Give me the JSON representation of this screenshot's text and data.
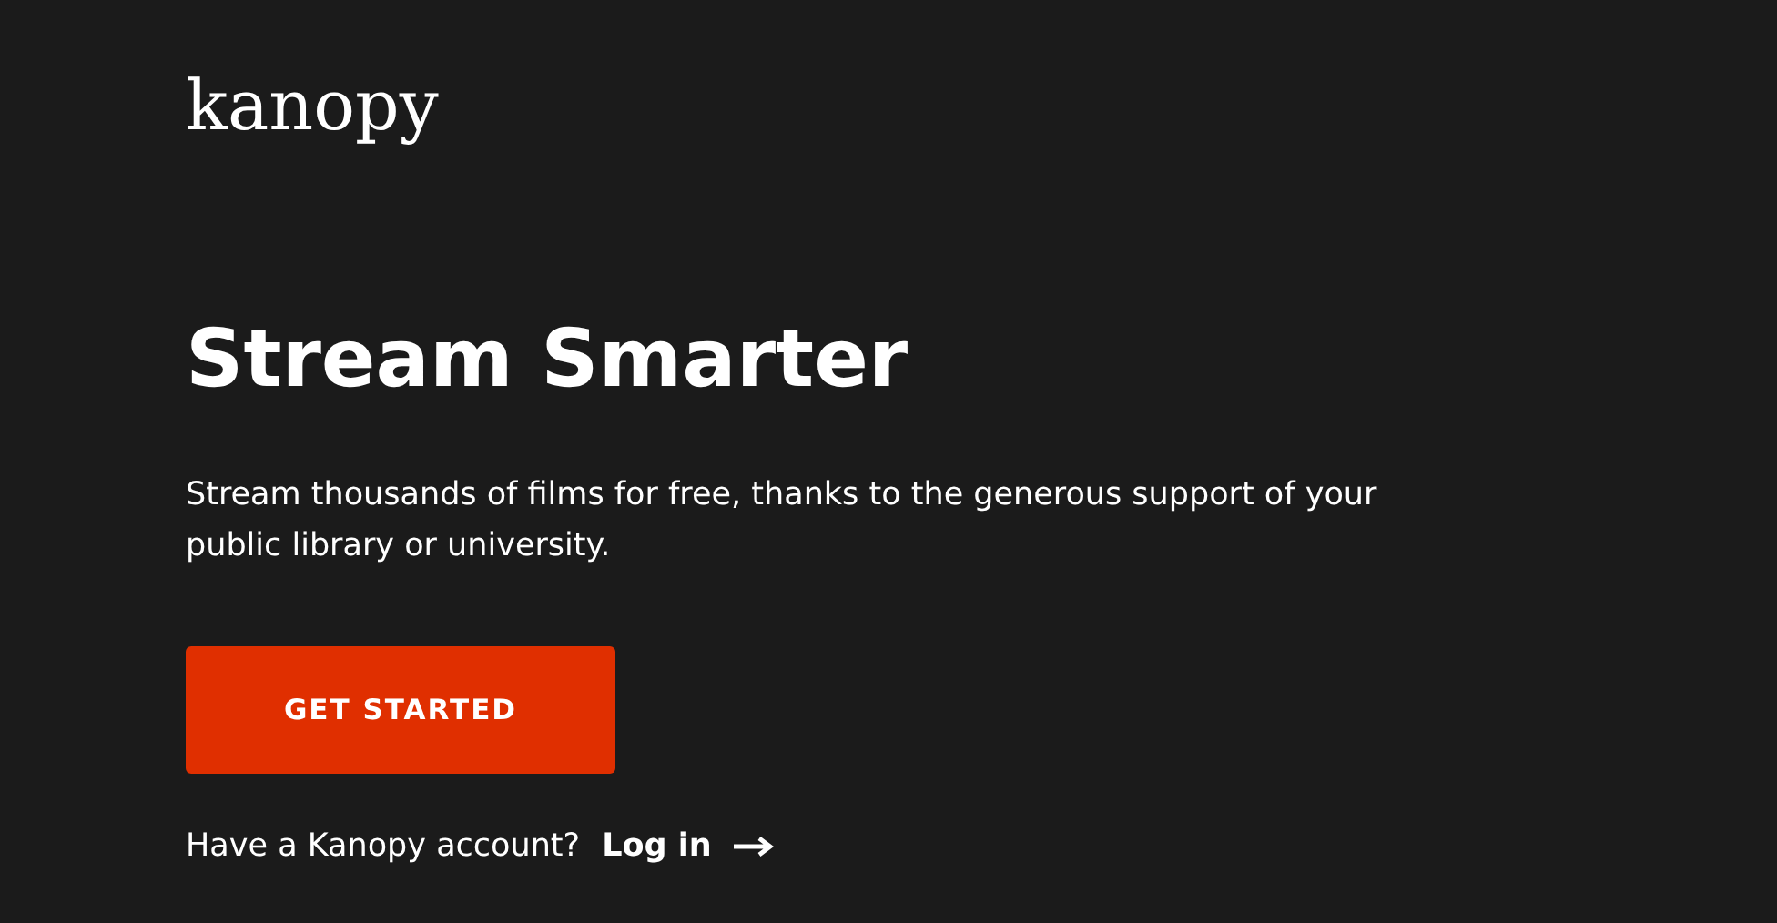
{
  "logo": "kanopy",
  "hero": {
    "title": "Stream Smarter",
    "description": "Stream thousands of films for free, thanks to the generous support of your public library or university.",
    "button": "GET STARTED"
  },
  "login": {
    "prompt": "Have a Kanopy account?",
    "link": "Log in"
  }
}
